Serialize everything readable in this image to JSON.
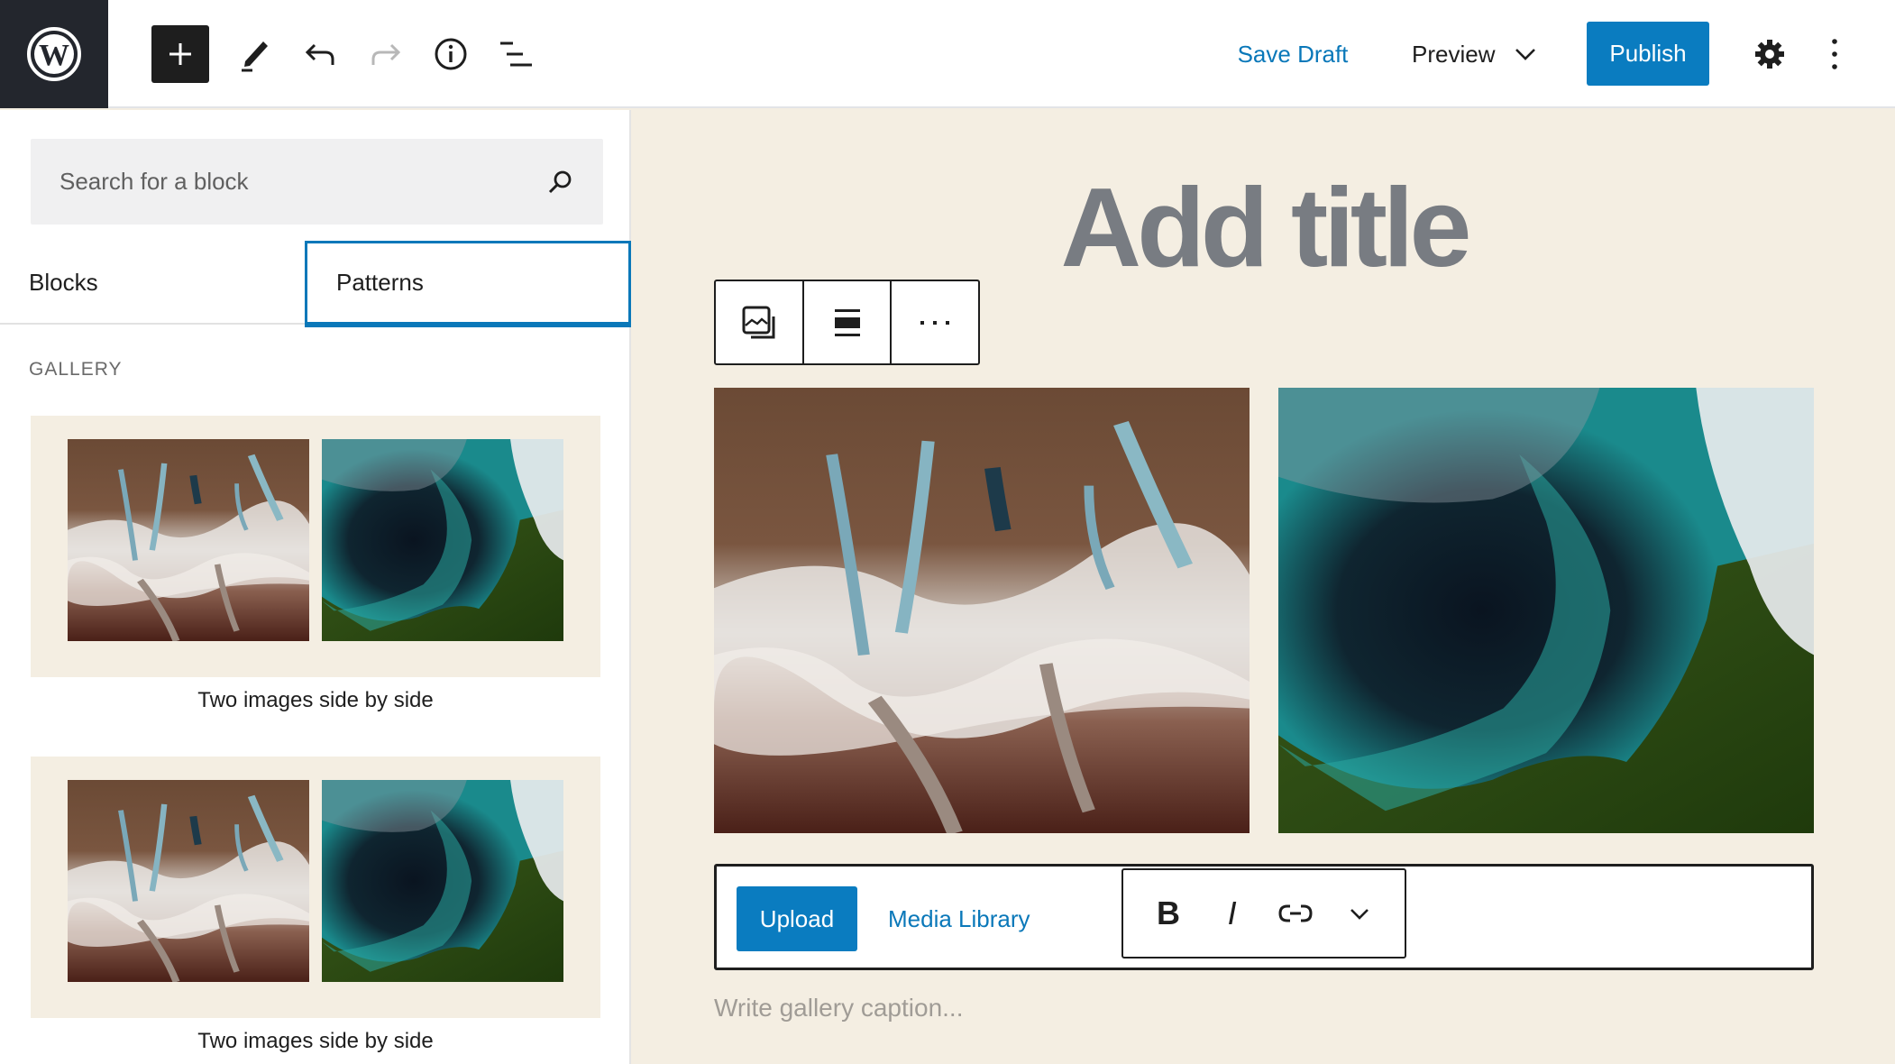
{
  "header": {
    "logo": "wordpress-logo",
    "toolbar_icons": [
      "plus-icon",
      "pencil-icon",
      "undo-icon",
      "redo-icon",
      "info-icon",
      "list-view-icon"
    ],
    "save_draft_label": "Save Draft",
    "preview_label": "Preview",
    "publish_label": "Publish",
    "settings_icon": "gear-icon",
    "options_icon": "kebab-vertical-icon",
    "colors": {
      "accent": "#0a7cc0",
      "logo_bg": "#23262d",
      "link": "#0a78b9"
    }
  },
  "sidebar": {
    "search": {
      "placeholder": "Search for a block",
      "value": ""
    },
    "tabs": [
      {
        "label": "Blocks",
        "active": false
      },
      {
        "label": "Patterns",
        "active": true
      }
    ],
    "category_label": "GALLERY",
    "patterns": [
      {
        "caption": "Two images side by side",
        "images": [
          "glacier-satellite-image",
          "coastal-bay-satellite-image"
        ]
      },
      {
        "caption": "Two images side by side",
        "images": [
          "glacier-satellite-image",
          "coastal-bay-satellite-image"
        ]
      }
    ]
  },
  "editor": {
    "title_placeholder": "Add title",
    "block_toolbar": [
      "gallery-icon",
      "align-wide-icon",
      "more-options-icon"
    ],
    "gallery_images": [
      "glacier-satellite-image",
      "coastal-bay-satellite-image"
    ],
    "upload_label": "Upload",
    "media_library_label": "Media Library",
    "format_toolbar": {
      "bold": "B",
      "italic": "I",
      "link": "link-icon",
      "more": "chevron-down-icon"
    },
    "caption_placeholder": "Write gallery caption..."
  }
}
